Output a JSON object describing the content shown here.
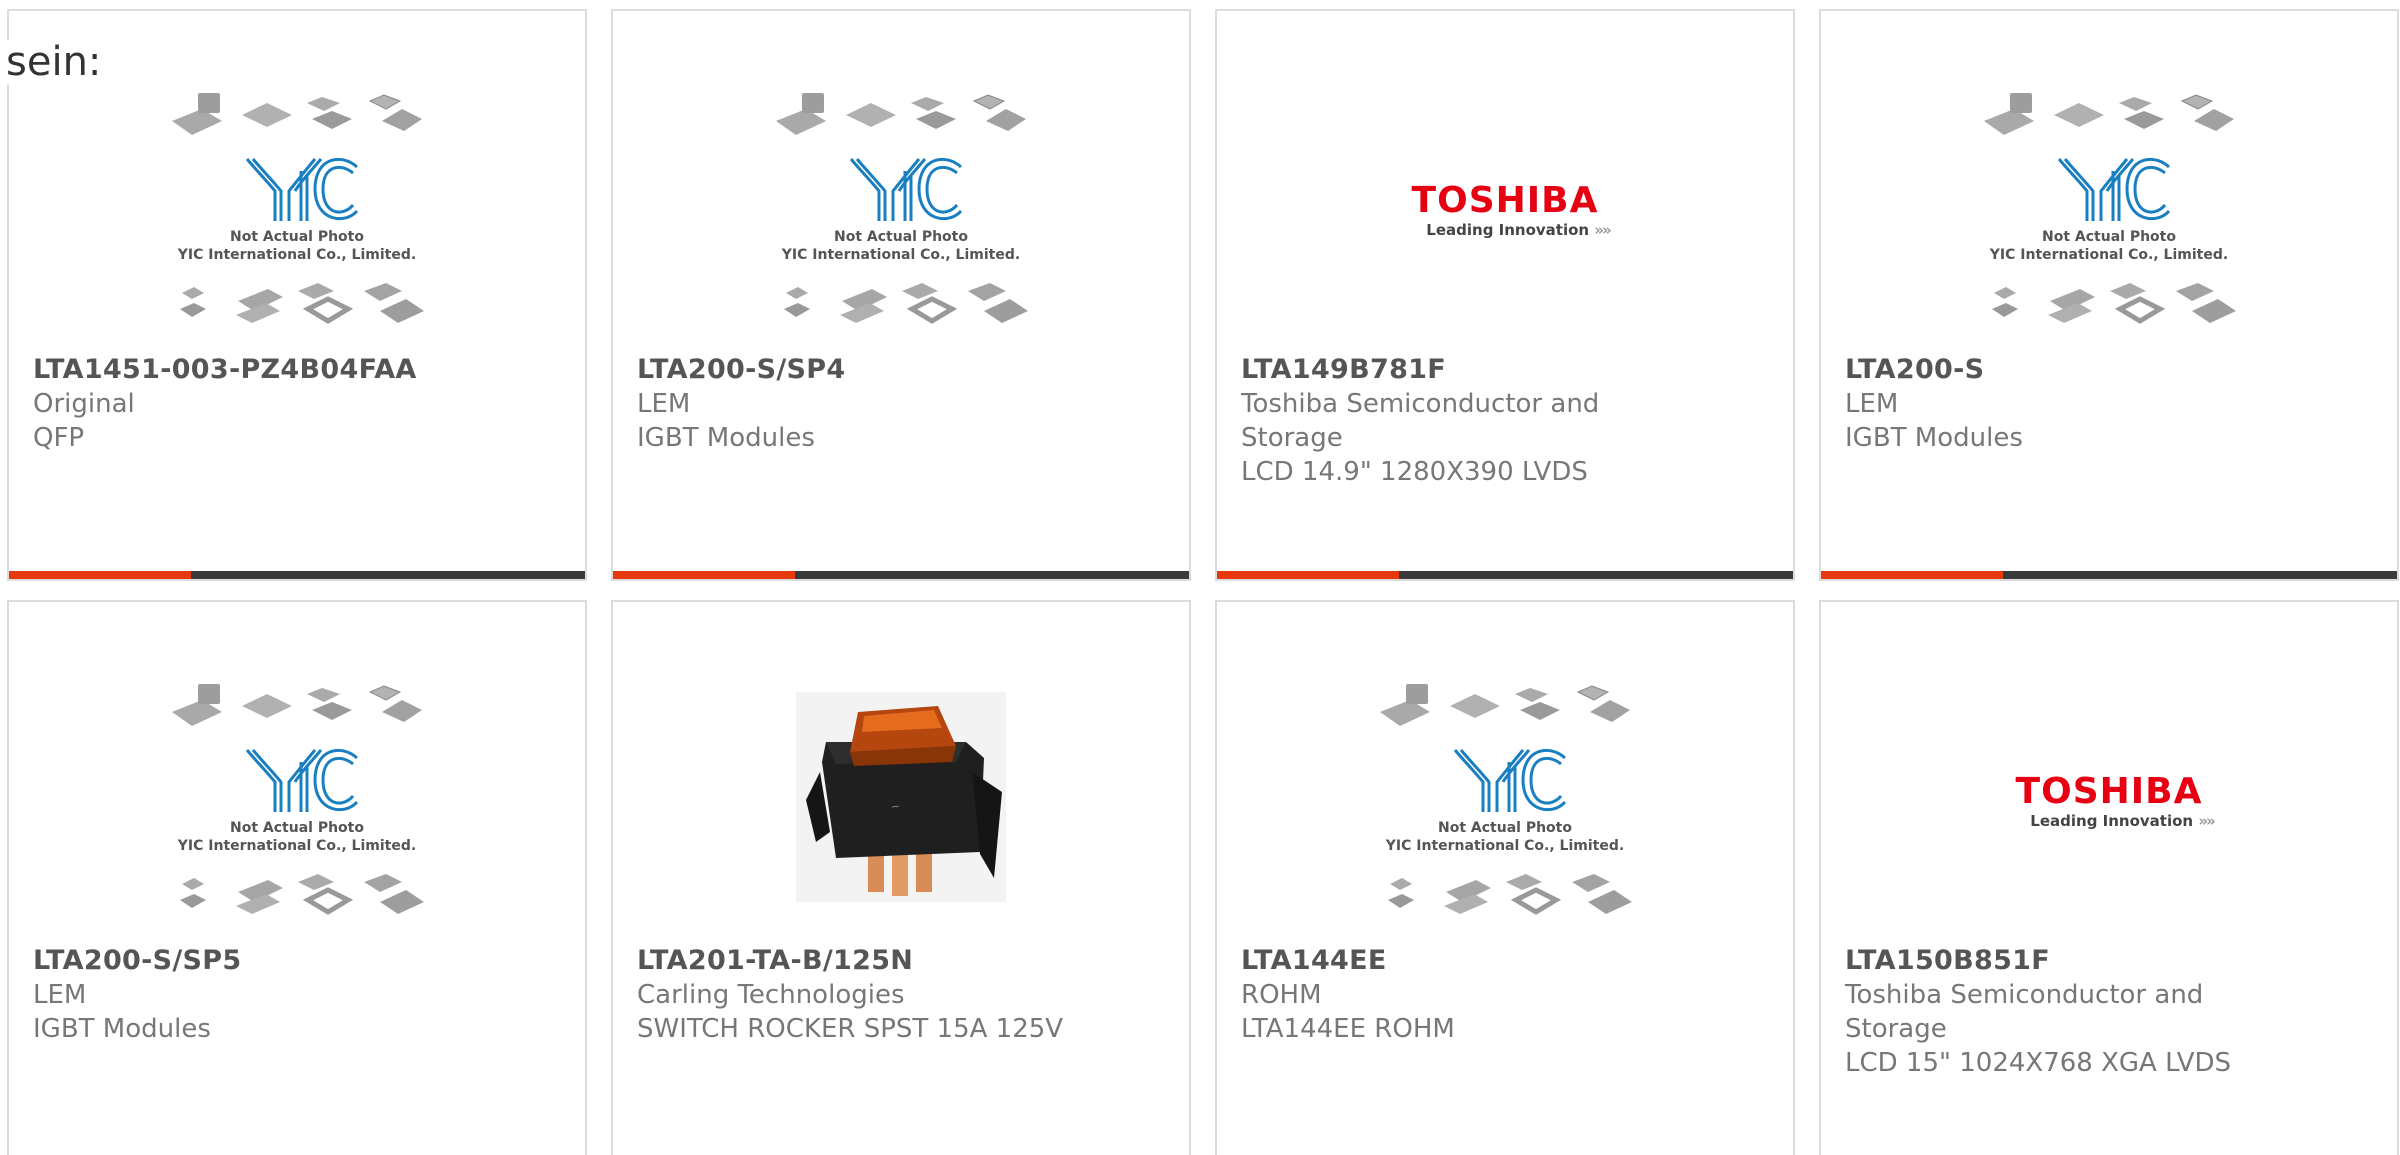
{
  "lead_text": "sein:",
  "placeholder": {
    "line1": "Not Actual Photo",
    "line2": "YIC International Co., Limited.",
    "logo": "YIC"
  },
  "toshiba_logo": {
    "brand": "TOSHIBA",
    "tagline": "Leading Innovation",
    "arrows": "»»"
  },
  "products": [
    {
      "part": "LTA1451-003-PZ4B04FAA",
      "manufacturer": "Original",
      "description": "QFP",
      "image": "yic-placeholder"
    },
    {
      "part": "LTA200-S/SP4",
      "manufacturer": "LEM",
      "description": "IGBT Modules",
      "image": "yic-placeholder"
    },
    {
      "part": "LTA149B781F",
      "manufacturer": "Toshiba Semiconductor and Storage",
      "description": "LCD 14.9\" 1280X390 LVDS",
      "image": "toshiba-logo"
    },
    {
      "part": "LTA200-S",
      "manufacturer": "LEM",
      "description": "IGBT Modules",
      "image": "yic-placeholder"
    },
    {
      "part": "LTA200-S/SP5",
      "manufacturer": "LEM",
      "description": "IGBT Modules",
      "image": "yic-placeholder"
    },
    {
      "part": "LTA201-TA-B/125N",
      "manufacturer": "Carling Technologies",
      "description": "SWITCH ROCKER SPST 15A 125V",
      "image": "rocker-switch-photo"
    },
    {
      "part": "LTA144EE",
      "manufacturer": "ROHM",
      "description": "LTA144EE ROHM",
      "image": "yic-placeholder"
    },
    {
      "part": "LTA150B851F",
      "manufacturer": "Toshiba Semiconductor and Storage",
      "description": "LCD 15\" 1024X768 XGA LVDS",
      "image": "toshiba-logo"
    }
  ],
  "colors": {
    "accent": "#e8380d",
    "bar": "#3a3a3a",
    "yic_blue": "#1a7fc1",
    "toshiba_red": "#e60012"
  }
}
